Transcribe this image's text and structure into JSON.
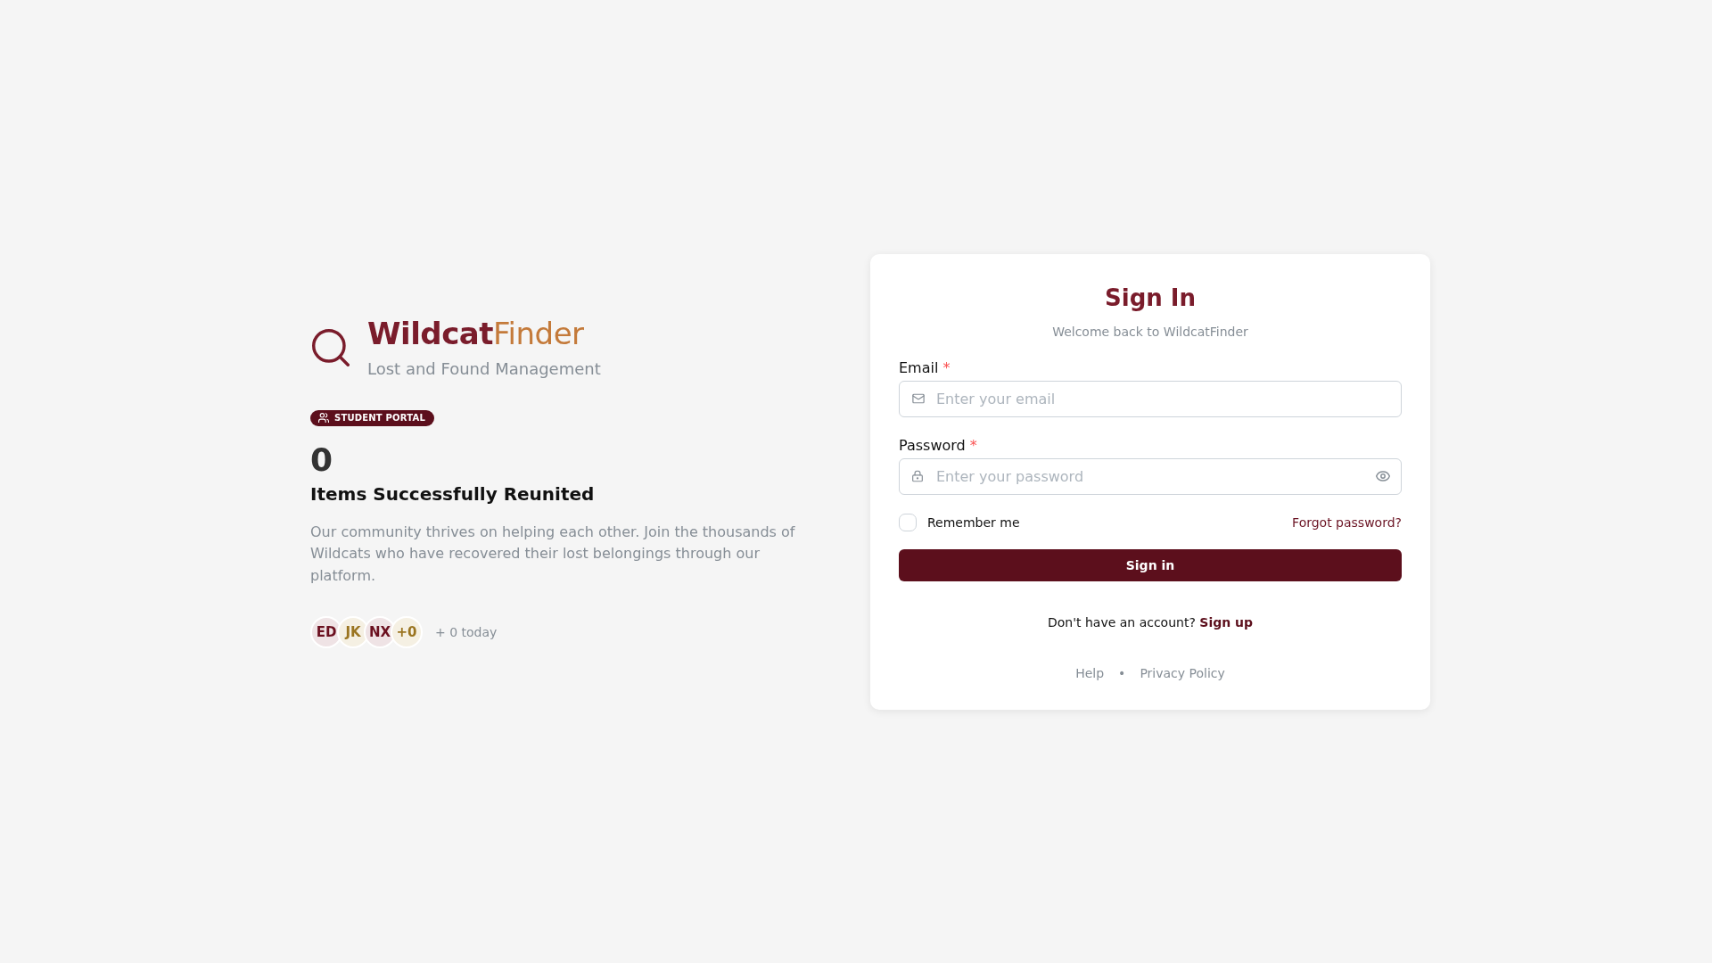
{
  "brand": {
    "name": "Wildcat",
    "name_accent": "Finder",
    "tagline": "Lost and Found Management"
  },
  "badge": {
    "label": "STUDENT PORTAL"
  },
  "stat": {
    "value": "0",
    "title": "Items Successfully Reunited",
    "description": "Our community thrives on helping each other. Join the thousands of Wildcats who have recovered their lost belongings through our platform."
  },
  "avatars": [
    {
      "initials": "ED"
    },
    {
      "initials": "JK"
    },
    {
      "initials": "NX"
    },
    {
      "initials": "+0"
    }
  ],
  "activity": "+ 0 today",
  "sign_in": {
    "title": "Sign In",
    "subtitle": "Welcome back to WildcatFinder",
    "fields": [
      {
        "kind": "email",
        "label": "Email",
        "required_mark": "*",
        "placeholder": "Enter your email"
      },
      {
        "kind": "password",
        "label": "Password",
        "required_mark": "*",
        "placeholder": "Enter your password"
      }
    ],
    "remember": {
      "label": "Remember me",
      "checked": false
    },
    "forgot_link": "Forgot password?",
    "submit": "Sign in",
    "signup_prompt": "Don't have an account?",
    "signup_link": "Sign up",
    "footer_links": [
      "Help",
      "Privacy Policy"
    ],
    "footer_separator": "•"
  }
}
